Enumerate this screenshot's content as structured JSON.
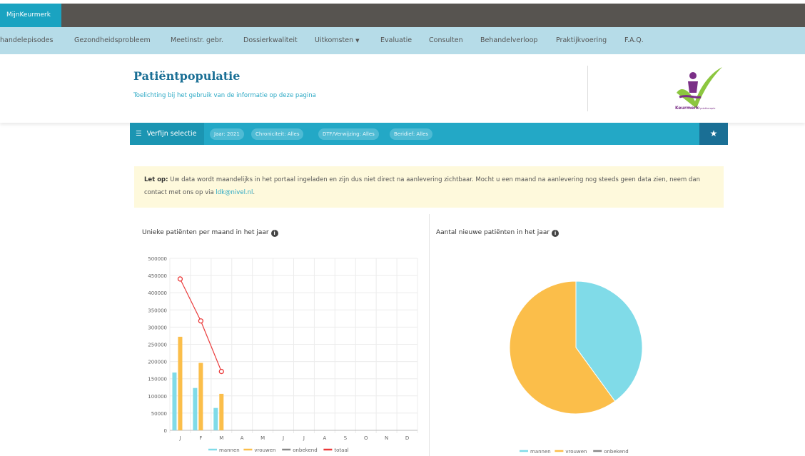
{
  "topbar": {
    "brand": "MijnKeurmerk"
  },
  "nav": {
    "items": [
      {
        "label": "handelepisodes"
      },
      {
        "label": "Gezondheidsprobleem"
      },
      {
        "label": "Meetinstr. gebr."
      },
      {
        "label": "Dossierkwaliteit"
      },
      {
        "label": "Uitkomsten"
      },
      {
        "label": "Evaluatie"
      },
      {
        "label": "Consulten"
      },
      {
        "label": "Behandelverloop"
      },
      {
        "label": "Praktijkvoering"
      },
      {
        "label": "F.A.Q."
      }
    ],
    "caret": "▼"
  },
  "header": {
    "title": "Patiëntpopulatie",
    "subtitle": "Toelichting bij het gebruik van de informatie op deze pagina",
    "logo_text": "Keurmerk",
    "logo_subtext": "Fysiotherapie"
  },
  "filter": {
    "button_label": "Verfijn selectie",
    "pills": [
      "Jaar: 2021",
      "Chroniciteit: Alles",
      "DTF/Verwijzing: Alles",
      "Beridief: Alles"
    ],
    "star_icon": "★"
  },
  "notice": {
    "bold": "Let op:",
    "text": " Uw data wordt maandelijks in het portaal ingeladen en zijn dus niet direct na aanlevering zichtbaar. Mocht u een maand na aanlevering nog steeds geen data zien, neem dan contact met ons op via ",
    "link": "ldk@nivel.nl",
    "end": "."
  },
  "chart_data": [
    {
      "type": "bar",
      "title": "Unieke patiënten per maand in het jaar",
      "categories": [
        "J",
        "F",
        "M",
        "A",
        "M",
        "J",
        "J",
        "A",
        "S",
        "O",
        "N",
        "D"
      ],
      "ylim": [
        0,
        500000
      ],
      "yticks": [
        "500000",
        "450000",
        "400000",
        "350000",
        "300000",
        "250000",
        "200000",
        "150000",
        "100000",
        "50000",
        "0"
      ],
      "series": [
        {
          "name": "mannen",
          "color": "#80dbe8",
          "values": [
            168000,
            123000,
            65000,
            null,
            null,
            null,
            null,
            null,
            null,
            null,
            null,
            null
          ]
        },
        {
          "name": "vrouwen",
          "color": "#fbbe4a",
          "values": [
            272000,
            196000,
            106000,
            null,
            null,
            null,
            null,
            null,
            null,
            null,
            null,
            null
          ]
        },
        {
          "name": "onbekend",
          "color": "#888888",
          "values": [
            0,
            0,
            0,
            null,
            null,
            null,
            null,
            null,
            null,
            null,
            null,
            null
          ]
        },
        {
          "name": "totaal",
          "color": "#ea3a3a",
          "type": "line",
          "values": [
            440000,
            318000,
            171000,
            null,
            null,
            null,
            null,
            null,
            null,
            null,
            null,
            null
          ]
        }
      ],
      "grid": true,
      "legend": "bottom"
    },
    {
      "type": "pie",
      "title": "Aantal nieuwe patiënten in het jaar",
      "slices": [
        {
          "name": "mannen",
          "value": 0.4,
          "color": "#80dbe8"
        },
        {
          "name": "vrouwen",
          "value": 0.6,
          "color": "#fbbe4a"
        },
        {
          "name": "onbekend",
          "value": 0.0,
          "color": "#888888"
        }
      ],
      "legend": "bottom"
    }
  ]
}
